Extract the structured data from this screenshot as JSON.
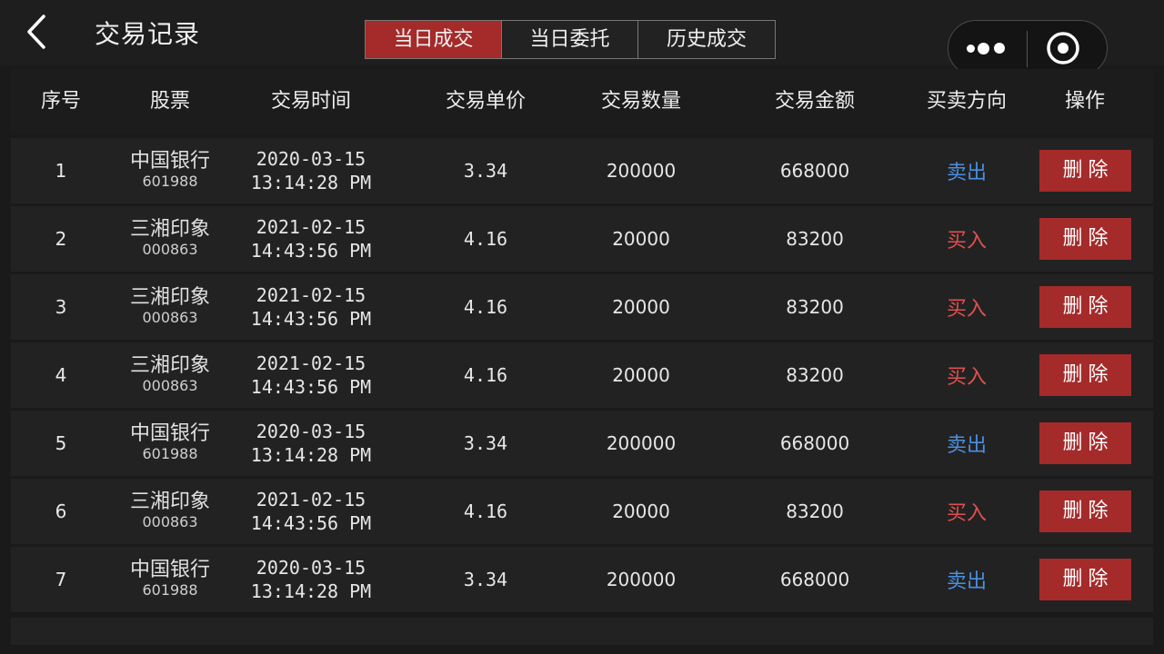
{
  "header": {
    "title": "交易记录",
    "tabs": [
      {
        "label": "当日成交",
        "active": true
      },
      {
        "label": "当日委托",
        "active": false
      },
      {
        "label": "历史成交",
        "active": false
      }
    ]
  },
  "table": {
    "columns": [
      "序号",
      "股票",
      "交易时间",
      "交易单价",
      "交易数量",
      "交易金额",
      "买卖方向",
      "操作"
    ],
    "rows": [
      {
        "no": "1",
        "name": "中国银行",
        "code": "601988",
        "date": "2020-03-15",
        "time": "13:14:28 PM",
        "price": "3.34",
        "qty": "200000",
        "amount": "668000",
        "dir": "卖出",
        "dir_type": "sell",
        "action": "删除"
      },
      {
        "no": "2",
        "name": "三湘印象",
        "code": "000863",
        "date": "2021-02-15",
        "time": "14:43:56 PM",
        "price": "4.16",
        "qty": "20000",
        "amount": "83200",
        "dir": "买入",
        "dir_type": "buy",
        "action": "删除"
      },
      {
        "no": "3",
        "name": "三湘印象",
        "code": "000863",
        "date": "2021-02-15",
        "time": "14:43:56 PM",
        "price": "4.16",
        "qty": "20000",
        "amount": "83200",
        "dir": "买入",
        "dir_type": "buy",
        "action": "删除"
      },
      {
        "no": "4",
        "name": "三湘印象",
        "code": "000863",
        "date": "2021-02-15",
        "time": "14:43:56 PM",
        "price": "4.16",
        "qty": "20000",
        "amount": "83200",
        "dir": "买入",
        "dir_type": "buy",
        "action": "删除"
      },
      {
        "no": "5",
        "name": "中国银行",
        "code": "601988",
        "date": "2020-03-15",
        "time": "13:14:28 PM",
        "price": "3.34",
        "qty": "200000",
        "amount": "668000",
        "dir": "卖出",
        "dir_type": "sell",
        "action": "删除"
      },
      {
        "no": "6",
        "name": "三湘印象",
        "code": "000863",
        "date": "2021-02-15",
        "time": "14:43:56 PM",
        "price": "4.16",
        "qty": "20000",
        "amount": "83200",
        "dir": "买入",
        "dir_type": "buy",
        "action": "删除"
      },
      {
        "no": "7",
        "name": "中国银行",
        "code": "601988",
        "date": "2020-03-15",
        "time": "13:14:28 PM",
        "price": "3.34",
        "qty": "200000",
        "amount": "668000",
        "dir": "卖出",
        "dir_type": "sell",
        "action": "删除"
      }
    ]
  },
  "colors": {
    "accent": "#a52a2a",
    "buy": "#e05050",
    "sell": "#4a8fe0",
    "background": "#1a1a1a"
  },
  "icons": {
    "back": "chevron-left-icon",
    "more": "more-dots-icon",
    "close": "target-circle-icon"
  }
}
